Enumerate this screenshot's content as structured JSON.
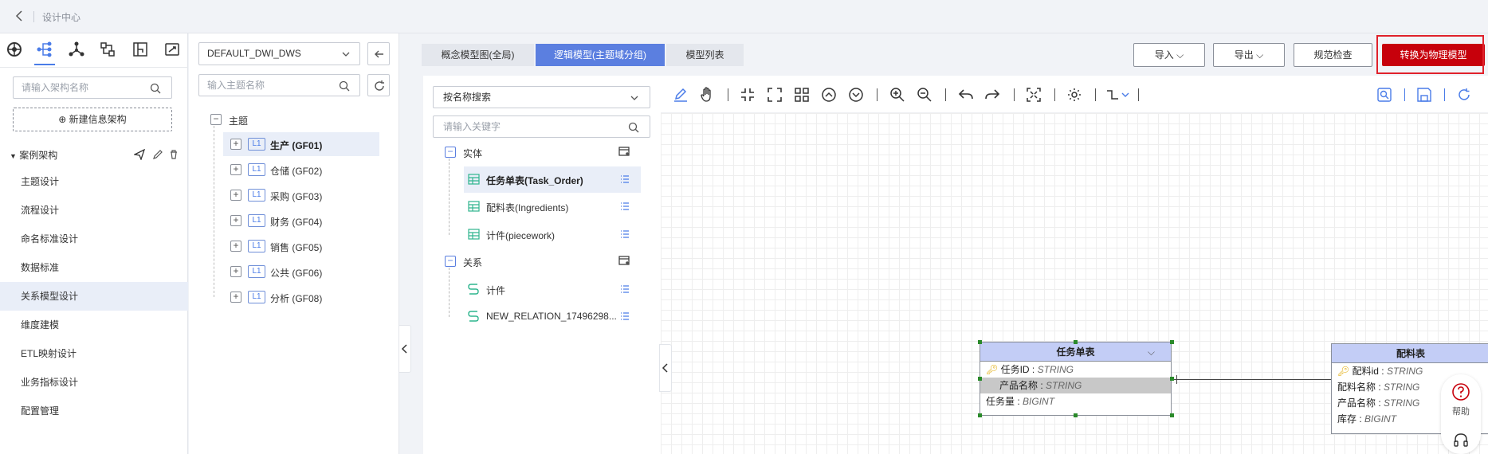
{
  "header": {
    "title": "设计中心",
    "back_icon": "chevron-left-icon"
  },
  "left_panel": {
    "top_icons": [
      "cube-icon",
      "hierarchy-icon",
      "network-icon",
      "tree-icon",
      "book-icon",
      "document-icon"
    ],
    "search": {
      "placeholder": "请输入架构名称"
    },
    "new_button": "⊕ 新建信息架构",
    "section": {
      "label": "案例架构",
      "actions": [
        "send-icon",
        "edit-icon",
        "delete-icon"
      ]
    },
    "nav_items": [
      {
        "label": "主题设计",
        "active": false
      },
      {
        "label": "流程设计",
        "active": false
      },
      {
        "label": "命名标准设计",
        "active": false
      },
      {
        "label": "数据标准",
        "active": false
      },
      {
        "label": "关系模型设计",
        "active": true
      },
      {
        "label": "维度建模",
        "active": false
      },
      {
        "label": "ETL映射设计",
        "active": false
      },
      {
        "label": "业务指标设计",
        "active": false
      },
      {
        "label": "配置管理",
        "active": false
      }
    ]
  },
  "theme_panel": {
    "db_select": "DEFAULT_DWI_DWS",
    "search": {
      "placeholder": "输入主题名称"
    },
    "root": "主题",
    "tag": "L1",
    "items": [
      {
        "label": "生产 (GF01)",
        "active": true
      },
      {
        "label": "仓储 (GF02)",
        "active": false
      },
      {
        "label": "采购 (GF03)",
        "active": false
      },
      {
        "label": "财务 (GF04)",
        "active": false
      },
      {
        "label": "销售 (GF05)",
        "active": false
      },
      {
        "label": "公共 (GF06)",
        "active": false
      },
      {
        "label": "分析 (GF08)",
        "active": false
      }
    ]
  },
  "tabs": [
    {
      "label": "概念模型图(全局)",
      "active": false
    },
    {
      "label": "逻辑模型(主题域分组)",
      "active": true
    },
    {
      "label": "模型列表",
      "active": false
    }
  ],
  "actions": {
    "import": "导入",
    "export": "导出",
    "check": "规范检查",
    "convert": "转换为物理模型"
  },
  "entity_panel": {
    "search_type": "按名称搜索",
    "keyword_placeholder": "请输入关键字",
    "entity_group": "实体",
    "entities": [
      {
        "label": "任务单表(Task_Order)",
        "active": true
      },
      {
        "label": "配料表(Ingredients)",
        "active": false
      },
      {
        "label": "计件(piecework)",
        "active": false
      }
    ],
    "relation_group": "关系",
    "relations": [
      {
        "label": "计件"
      },
      {
        "label": "NEW_RELATION_17496298..."
      }
    ]
  },
  "canvas": {
    "toolbar_icons": [
      "pen-icon",
      "hand-icon",
      "compress-icon",
      "expand-icon",
      "grid-icon",
      "arrow-up-circle-icon",
      "arrow-down-circle-icon",
      "zoom-in-icon",
      "zoom-out-icon",
      "undo-icon",
      "redo-icon",
      "fullscreen-icon",
      "settings-icon",
      "connector-icon"
    ],
    "right_icons": [
      "search-icon",
      "save-icon",
      "refresh-icon"
    ],
    "entities": [
      {
        "title": "任务单表",
        "fields": [
          {
            "name": "任务ID",
            "type": "STRING",
            "key": true
          },
          {
            "name": "产品名称",
            "type": "STRING",
            "key": false
          },
          {
            "name": "任务量",
            "type": "BIGINT",
            "key": false
          }
        ]
      },
      {
        "title": "配料表",
        "fields": [
          {
            "name": "配料id",
            "type": "STRING",
            "key": true
          },
          {
            "name": "配料名称",
            "type": "STRING",
            "key": false
          },
          {
            "name": "产品名称",
            "type": "STRING",
            "key": false
          },
          {
            "name": "库存",
            "type": "BIGINT",
            "key": false
          }
        ]
      }
    ]
  },
  "help": {
    "label": "帮助"
  },
  "colors": {
    "accent": "#5b7fe0",
    "danger": "#c7000b",
    "active_bg": "#e9eef8",
    "entity_head": "#c3cdf6"
  }
}
